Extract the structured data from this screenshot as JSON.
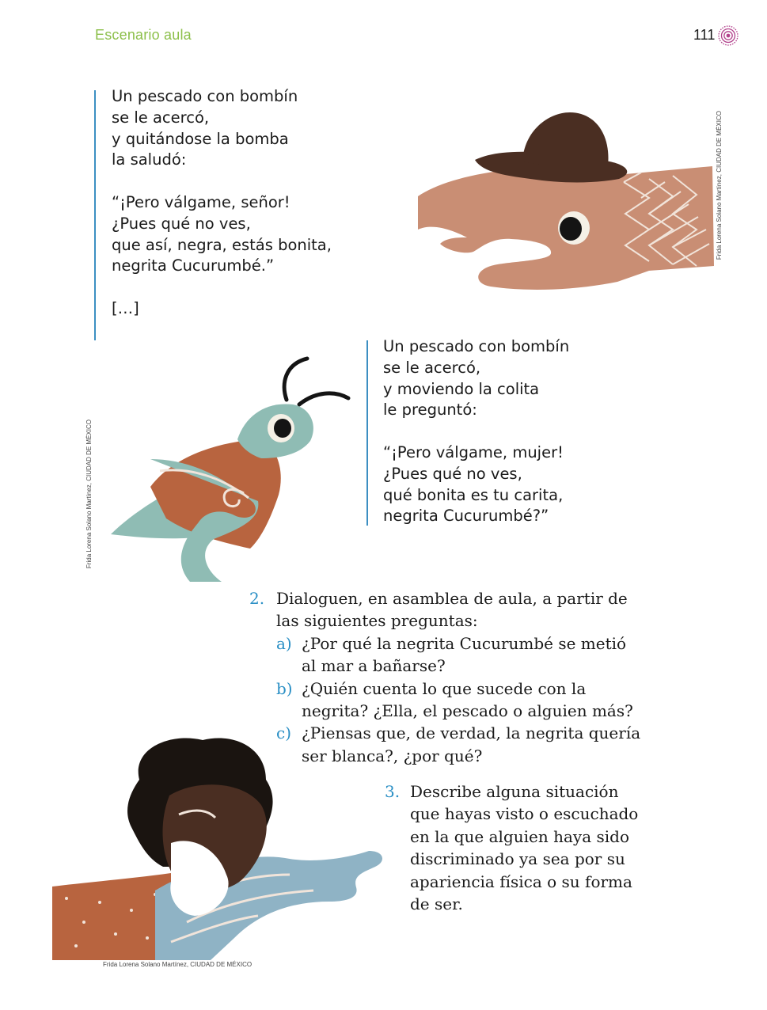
{
  "header": {
    "section": "Escenario aula",
    "page_number": "111"
  },
  "poem1": {
    "stanza1": [
      "Un pescado con bombín",
      "se le acercó,",
      "y quitándose la bomba",
      "la saludó:"
    ],
    "stanza2": [
      "“¡Pero válgame, señor!",
      "¿Pues qué no ves,",
      "que así, negra, estás bonita,",
      "negrita Cucurumbé.”"
    ],
    "ellipsis": "[…]"
  },
  "poem2": {
    "stanza1": [
      "Un pescado con bombín",
      "se le acercó,",
      "y moviendo la colita",
      "le preguntó:"
    ],
    "stanza2": [
      "“¡Pero válgame, mujer!",
      "¿Pues qué no ves,",
      "qué bonita es tu carita,",
      "negrita Cucurumbé?”"
    ]
  },
  "credits": {
    "fish": "Frida Lorena Solano Martínez, CIUDAD DE MÉXICO",
    "grasshopper": "Frida Lorena Solano Martínez, CIUDAD DE MÉXICO",
    "girl": "Frida Lorena Solano Martínez, CIUDAD DE MÉXICO"
  },
  "activity2": {
    "number": "2.",
    "text_lines": [
      "Dialoguen, en asamblea de aula, a partir de",
      "las siguientes preguntas:"
    ],
    "items": [
      {
        "letter": "a)",
        "lines": [
          "¿Por qué la negrita Cucurumbé se metió",
          "al mar a bañarse?"
        ]
      },
      {
        "letter": "b)",
        "lines": [
          "¿Quién cuenta lo que sucede con la",
          "negrita? ¿Ella, el pescado o alguien más?"
        ]
      },
      {
        "letter": "c)",
        "lines": [
          "¿Piensas que, de verdad, la negrita quería",
          "ser blanca?, ¿por qué?"
        ]
      }
    ]
  },
  "activity3": {
    "number": "3.",
    "text_lines": [
      "Describe alguna situación",
      "que hayas visto o escuchado",
      "en la que alguien haya sido",
      "discriminado ya sea por su",
      "apariencia física o su forma",
      "de ser."
    ]
  },
  "colors": {
    "accent_green": "#8cbf4a",
    "accent_blue": "#2a8fc5",
    "ornament_pink": "#b2428c",
    "fish_salmon": "#c98e74",
    "hat_brown": "#4a2e22",
    "grasshopper_teal": "#8fbcb4",
    "terracotta": "#b8643f",
    "sleeve_blue": "#8fb3c5"
  }
}
